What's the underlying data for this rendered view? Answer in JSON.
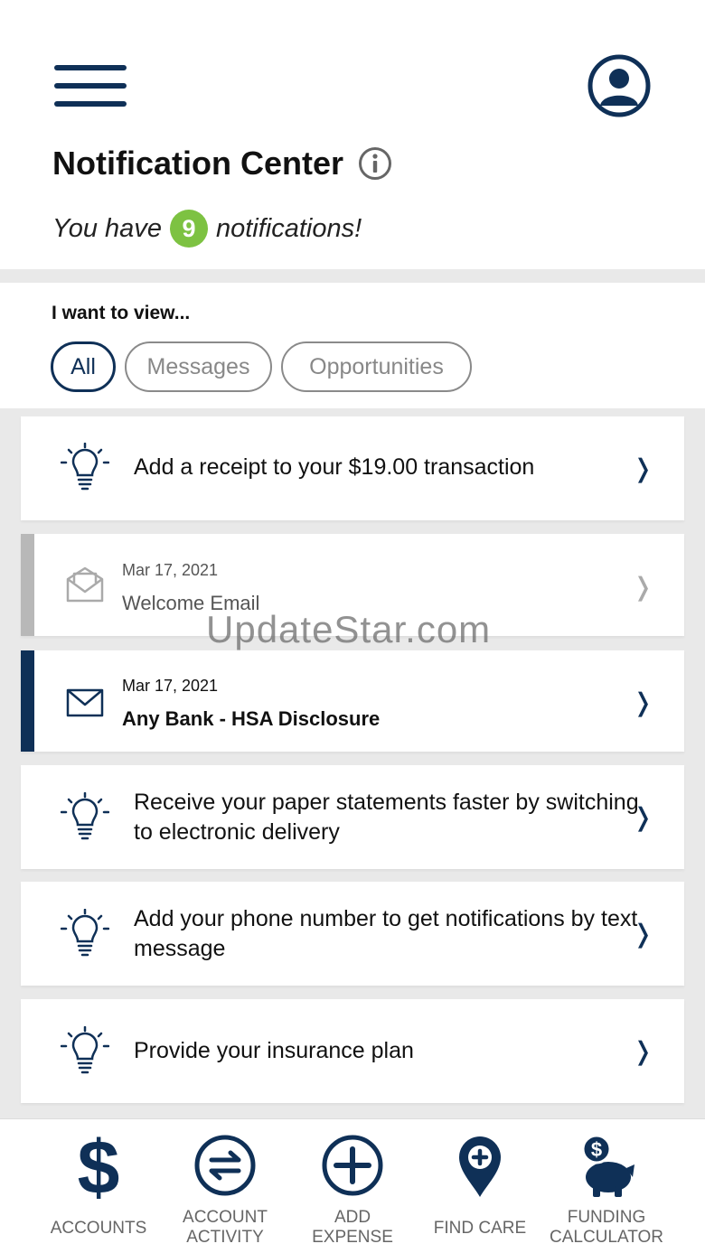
{
  "header": {
    "title": "Notification Center",
    "notif_prefix": "You have",
    "notif_count": "9",
    "notif_suffix": "notifications!"
  },
  "filters": {
    "label": "I want to view...",
    "options": [
      "All",
      "Messages",
      "Opportunities"
    ],
    "selected": "All"
  },
  "notifications": [
    {
      "type": "opportunity",
      "icon": "lightbulb-icon",
      "text": "Add a receipt to your $19.00 transaction"
    },
    {
      "type": "message",
      "icon": "open-envelope-icon",
      "status": "read",
      "date": "Mar 17, 2021",
      "subject": "Welcome Email"
    },
    {
      "type": "message",
      "icon": "envelope-icon",
      "status": "unread",
      "date": "Mar 17, 2021",
      "subject": "Any Bank - HSA Disclosure"
    },
    {
      "type": "opportunity",
      "icon": "lightbulb-icon",
      "text": "Receive your paper statements faster by switching to electronic delivery"
    },
    {
      "type": "opportunity",
      "icon": "lightbulb-icon",
      "text": "Add your phone number to get notifications by text message"
    },
    {
      "type": "opportunity",
      "icon": "lightbulb-icon",
      "text": "Provide your insurance plan"
    }
  ],
  "watermark": "UpdateStar.com",
  "bottom_nav": [
    {
      "label": "ACCOUNTS",
      "icon": "dollar-icon"
    },
    {
      "label": "ACCOUNT\nACTIVITY",
      "icon": "transfer-arrows-icon"
    },
    {
      "label": "ADD\nEXPENSE",
      "icon": "plus-circle-icon"
    },
    {
      "label": "FIND CARE",
      "icon": "map-pin-plus-icon"
    },
    {
      "label": "FUNDING\nCALCULATOR",
      "icon": "piggy-bank-icon"
    }
  ],
  "colors": {
    "brand_navy": "#0f3057",
    "badge_green": "#7dc242",
    "read_bar_gray": "#b8b8b8",
    "background_gray": "#e9e9e9"
  }
}
